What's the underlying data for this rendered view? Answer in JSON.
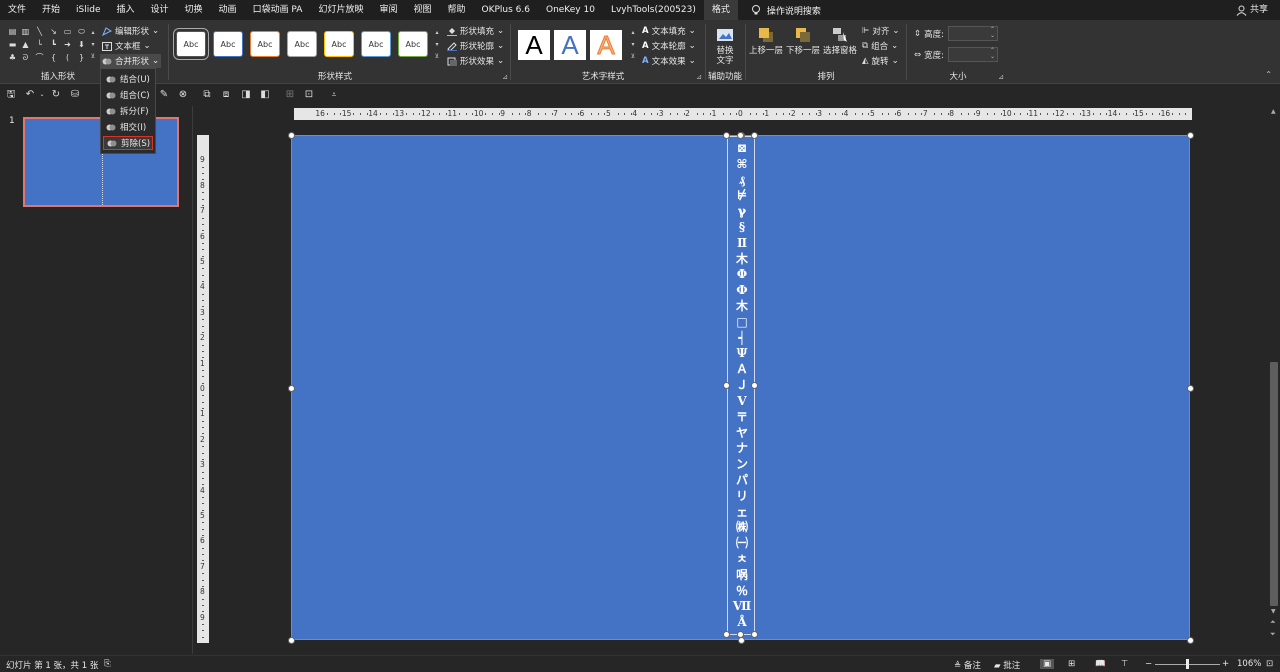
{
  "menubar": {
    "tabs": [
      {
        "label": "文件",
        "active": false
      },
      {
        "label": "开始",
        "active": false
      },
      {
        "label": "iSlide",
        "active": false
      },
      {
        "label": "插入",
        "active": false
      },
      {
        "label": "设计",
        "active": false
      },
      {
        "label": "切换",
        "active": false
      },
      {
        "label": "动画",
        "active": false
      },
      {
        "label": "口袋动画 PA",
        "active": false
      },
      {
        "label": "幻灯片放映",
        "active": false
      },
      {
        "label": "审阅",
        "active": false
      },
      {
        "label": "视图",
        "active": false
      },
      {
        "label": "帮助",
        "active": false
      },
      {
        "label": "OKPlus 6.6",
        "active": false
      },
      {
        "label": "OneKey 10",
        "active": false
      },
      {
        "label": "LvyhTools(200523)",
        "active": false
      },
      {
        "label": "格式",
        "active": true
      }
    ],
    "search_label": "操作说明搜索",
    "share_label": "共享"
  },
  "ribbon": {
    "insert_shapes": {
      "label": "插入形状",
      "edit_shape": "编辑形状",
      "text_box": "文本框",
      "merge_shapes": "合并形状"
    },
    "shape_styles": {
      "label": "形状样式",
      "swatch_text": "Abc",
      "swatch_colors": [
        "#555555",
        "#4472c4",
        "#ed7d31",
        "#a5a5a5",
        "#ffc000",
        "#5b9bd5",
        "#70ad47"
      ],
      "fill": "形状填充",
      "outline": "形状轮廓",
      "effects": "形状效果"
    },
    "wordart": {
      "label": "艺术字样式",
      "letter": "A",
      "text_fill": "文本填充",
      "text_outline": "文本轮廓",
      "text_effects": "文本效果"
    },
    "accessibility": {
      "label": "辅助功能",
      "alt_text_line1": "替换",
      "alt_text_line2": "文字"
    },
    "arrange": {
      "label": "排列",
      "bring_forward": "上移一层",
      "send_backward": "下移一层",
      "selection_pane": "选择窗格",
      "align": "对齐",
      "group": "组合",
      "rotate": "旋转"
    },
    "size": {
      "label": "大小",
      "height_label": "高度:",
      "width_label": "宽度:",
      "height_value": "",
      "width_value": ""
    }
  },
  "merge_dropdown": {
    "items": [
      {
        "label": "结合(U)",
        "highlighted": false
      },
      {
        "label": "组合(C)",
        "highlighted": false
      },
      {
        "label": "拆分(F)",
        "highlighted": false
      },
      {
        "label": "相交(I)",
        "highlighted": false
      },
      {
        "label": "剪除(S)",
        "highlighted": true
      }
    ]
  },
  "slides_panel": {
    "slide_number": "1"
  },
  "ruler": {
    "h_labels": [
      "16",
      "15",
      "14",
      "13",
      "12",
      "11",
      "10",
      "9",
      "8",
      "7",
      "6",
      "5",
      "4",
      "3",
      "2",
      "1",
      "0",
      "1",
      "2",
      "3",
      "4",
      "5",
      "6",
      "7",
      "8",
      "9",
      "10",
      "11",
      "12",
      "13",
      "14",
      "15",
      "16"
    ],
    "v_labels": [
      "9",
      "8",
      "7",
      "6",
      "5",
      "4",
      "3",
      "2",
      "1",
      "0",
      "1",
      "2",
      "3",
      "4",
      "5",
      "6",
      "7",
      "8",
      "9"
    ]
  },
  "slide": {
    "background": "#4472c4",
    "vertical_text": [
      "⊠",
      "⌘",
      "₰",
      "⊭",
      "ℽ",
      "§",
      "Ⅱ",
      "⽊",
      "Φ",
      "Ф",
      "⽊",
      "□",
      "┥",
      "Ψ",
      "Ａ",
      "Ｊ",
      "Ⅴ",
      "〒",
      "ヤ",
      "ナ",
      "ン",
      "パ",
      "リ",
      "ェ",
      "㈱",
      "㈠",
      "ㅊ",
      "㖞",
      "％",
      "Ⅶ",
      "Å"
    ]
  },
  "statusbar": {
    "slide_info": "幻灯片 第 1 张，共 1 张",
    "notes": "备注",
    "comments": "批注",
    "zoom": "106%"
  },
  "colors": {
    "accent_red": "#d9332a",
    "selection_thumb_border": "#e0776f",
    "slide_blue": "#4472c4"
  }
}
